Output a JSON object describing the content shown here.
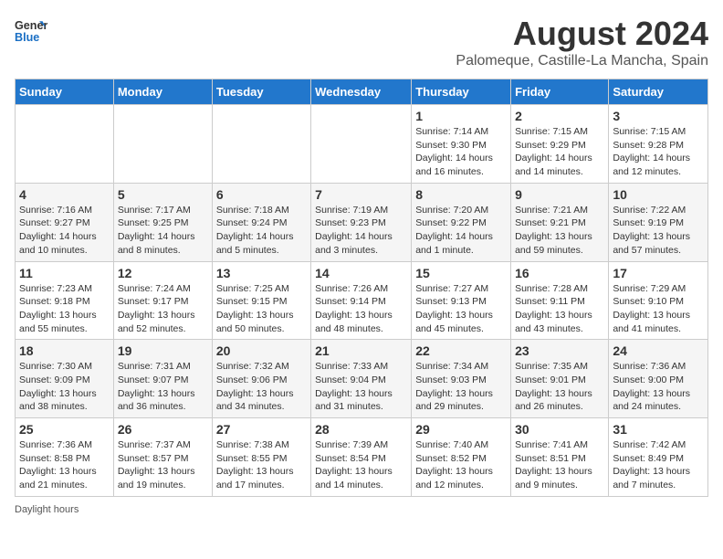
{
  "header": {
    "logo_general": "General",
    "logo_blue": "Blue",
    "title": "August 2024",
    "subtitle": "Palomeque, Castille-La Mancha, Spain"
  },
  "days_of_week": [
    "Sunday",
    "Monday",
    "Tuesday",
    "Wednesday",
    "Thursday",
    "Friday",
    "Saturday"
  ],
  "weeks": [
    [
      {
        "day": "",
        "info": ""
      },
      {
        "day": "",
        "info": ""
      },
      {
        "day": "",
        "info": ""
      },
      {
        "day": "",
        "info": ""
      },
      {
        "day": "1",
        "info": "Sunrise: 7:14 AM\nSunset: 9:30 PM\nDaylight: 14 hours and 16 minutes."
      },
      {
        "day": "2",
        "info": "Sunrise: 7:15 AM\nSunset: 9:29 PM\nDaylight: 14 hours and 14 minutes."
      },
      {
        "day": "3",
        "info": "Sunrise: 7:15 AM\nSunset: 9:28 PM\nDaylight: 14 hours and 12 minutes."
      }
    ],
    [
      {
        "day": "4",
        "info": "Sunrise: 7:16 AM\nSunset: 9:27 PM\nDaylight: 14 hours and 10 minutes."
      },
      {
        "day": "5",
        "info": "Sunrise: 7:17 AM\nSunset: 9:25 PM\nDaylight: 14 hours and 8 minutes."
      },
      {
        "day": "6",
        "info": "Sunrise: 7:18 AM\nSunset: 9:24 PM\nDaylight: 14 hours and 5 minutes."
      },
      {
        "day": "7",
        "info": "Sunrise: 7:19 AM\nSunset: 9:23 PM\nDaylight: 14 hours and 3 minutes."
      },
      {
        "day": "8",
        "info": "Sunrise: 7:20 AM\nSunset: 9:22 PM\nDaylight: 14 hours and 1 minute."
      },
      {
        "day": "9",
        "info": "Sunrise: 7:21 AM\nSunset: 9:21 PM\nDaylight: 13 hours and 59 minutes."
      },
      {
        "day": "10",
        "info": "Sunrise: 7:22 AM\nSunset: 9:19 PM\nDaylight: 13 hours and 57 minutes."
      }
    ],
    [
      {
        "day": "11",
        "info": "Sunrise: 7:23 AM\nSunset: 9:18 PM\nDaylight: 13 hours and 55 minutes."
      },
      {
        "day": "12",
        "info": "Sunrise: 7:24 AM\nSunset: 9:17 PM\nDaylight: 13 hours and 52 minutes."
      },
      {
        "day": "13",
        "info": "Sunrise: 7:25 AM\nSunset: 9:15 PM\nDaylight: 13 hours and 50 minutes."
      },
      {
        "day": "14",
        "info": "Sunrise: 7:26 AM\nSunset: 9:14 PM\nDaylight: 13 hours and 48 minutes."
      },
      {
        "day": "15",
        "info": "Sunrise: 7:27 AM\nSunset: 9:13 PM\nDaylight: 13 hours and 45 minutes."
      },
      {
        "day": "16",
        "info": "Sunrise: 7:28 AM\nSunset: 9:11 PM\nDaylight: 13 hours and 43 minutes."
      },
      {
        "day": "17",
        "info": "Sunrise: 7:29 AM\nSunset: 9:10 PM\nDaylight: 13 hours and 41 minutes."
      }
    ],
    [
      {
        "day": "18",
        "info": "Sunrise: 7:30 AM\nSunset: 9:09 PM\nDaylight: 13 hours and 38 minutes."
      },
      {
        "day": "19",
        "info": "Sunrise: 7:31 AM\nSunset: 9:07 PM\nDaylight: 13 hours and 36 minutes."
      },
      {
        "day": "20",
        "info": "Sunrise: 7:32 AM\nSunset: 9:06 PM\nDaylight: 13 hours and 34 minutes."
      },
      {
        "day": "21",
        "info": "Sunrise: 7:33 AM\nSunset: 9:04 PM\nDaylight: 13 hours and 31 minutes."
      },
      {
        "day": "22",
        "info": "Sunrise: 7:34 AM\nSunset: 9:03 PM\nDaylight: 13 hours and 29 minutes."
      },
      {
        "day": "23",
        "info": "Sunrise: 7:35 AM\nSunset: 9:01 PM\nDaylight: 13 hours and 26 minutes."
      },
      {
        "day": "24",
        "info": "Sunrise: 7:36 AM\nSunset: 9:00 PM\nDaylight: 13 hours and 24 minutes."
      }
    ],
    [
      {
        "day": "25",
        "info": "Sunrise: 7:36 AM\nSunset: 8:58 PM\nDaylight: 13 hours and 21 minutes."
      },
      {
        "day": "26",
        "info": "Sunrise: 7:37 AM\nSunset: 8:57 PM\nDaylight: 13 hours and 19 minutes."
      },
      {
        "day": "27",
        "info": "Sunrise: 7:38 AM\nSunset: 8:55 PM\nDaylight: 13 hours and 17 minutes."
      },
      {
        "day": "28",
        "info": "Sunrise: 7:39 AM\nSunset: 8:54 PM\nDaylight: 13 hours and 14 minutes."
      },
      {
        "day": "29",
        "info": "Sunrise: 7:40 AM\nSunset: 8:52 PM\nDaylight: 13 hours and 12 minutes."
      },
      {
        "day": "30",
        "info": "Sunrise: 7:41 AM\nSunset: 8:51 PM\nDaylight: 13 hours and 9 minutes."
      },
      {
        "day": "31",
        "info": "Sunrise: 7:42 AM\nSunset: 8:49 PM\nDaylight: 13 hours and 7 minutes."
      }
    ]
  ],
  "footer": {
    "daylight_label": "Daylight hours"
  }
}
